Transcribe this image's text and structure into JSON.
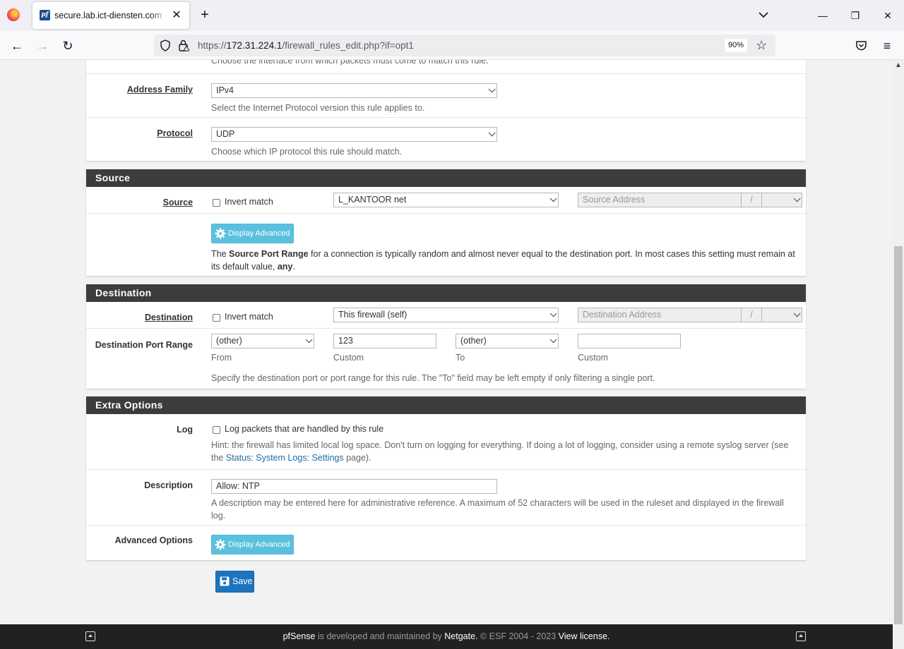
{
  "browser": {
    "tab_title": "secure.lab.ict-diensten.com - Fi",
    "favicon_text": "pf",
    "url_prefix": "https://",
    "url_host": "172.31.224.1",
    "url_path": "/firewall_rules_edit.php?if=opt1",
    "zoom": "90%"
  },
  "top": {
    "interface_help": "Choose the interface from which packets must come to match this rule.",
    "address_family_label": "Address Family",
    "address_family_value": "IPv4",
    "address_family_help": "Select the Internet Protocol version this rule applies to.",
    "protocol_label": "Protocol",
    "protocol_value": "UDP",
    "protocol_help": "Choose which IP protocol this rule should match."
  },
  "source": {
    "heading": "Source",
    "label": "Source",
    "invert_label": "Invert match",
    "type_value": "L_KANTOOR net",
    "address_placeholder": "Source Address",
    "slash": "/",
    "advanced_button": "Display Advanced",
    "help_pre": "The ",
    "help_bold": "Source Port Range",
    "help_mid": " for a connection is typically random and almost never equal to the destination port. In most cases this setting must remain at its default value, ",
    "help_bold2": "any",
    "help_post": "."
  },
  "destination": {
    "heading": "Destination",
    "label": "Destination",
    "invert_label": "Invert match",
    "type_value": "This firewall (self)",
    "address_placeholder": "Destination Address",
    "slash": "/",
    "port_range_label": "Destination Port Range",
    "from_select": "(other)",
    "from_custom": "123",
    "to_select": "(other)",
    "to_custom": "",
    "sub_from": "From",
    "sub_custom1": "Custom",
    "sub_to": "To",
    "sub_custom2": "Custom",
    "port_help": "Specify the destination port or port range for this rule. The \"To\" field may be left empty if only filtering a single port."
  },
  "extra": {
    "heading": "Extra Options",
    "log_label": "Log",
    "log_check_label": "Log packets that are handled by this rule",
    "log_help_pre": "Hint: the firewall has limited local log space. Don't turn on logging for everything. If doing a lot of logging, consider using a remote syslog server (see the ",
    "log_help_link": "Status: System Logs: Settings",
    "log_help_post": " page).",
    "description_label": "Description",
    "description_value": "Allow: NTP",
    "description_help": "A description may be entered here for administrative reference. A maximum of 52 characters will be used in the ruleset and displayed in the firewall log.",
    "advanced_label": "Advanced Options",
    "advanced_button": "Display Advanced"
  },
  "save_label": "Save",
  "footer": {
    "brand": "pfSense",
    "text1": " is developed and maintained by ",
    "company": "Netgate.",
    "text2": " © ESF 2004 - 2023 ",
    "license": "View license."
  }
}
